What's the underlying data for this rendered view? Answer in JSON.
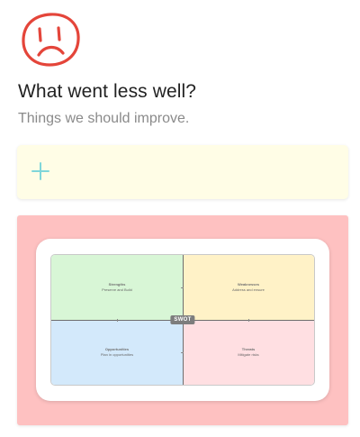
{
  "header": {
    "icon": "sad-face-icon",
    "icon_color": "#e4453a",
    "title": "What went less well?",
    "subtitle": "Things we should improve."
  },
  "add_card": {
    "icon": "plus-icon",
    "icon_color": "#7fd6da",
    "background": "#fffde6"
  },
  "note": {
    "background": "#fec1c1",
    "swot": {
      "badge": "SWOT",
      "quadrants": [
        {
          "title": "Strengths",
          "caption": "Preserve and Build"
        },
        {
          "title": "Weaknesses",
          "caption": "Address and ensure"
        },
        {
          "title": "Opportunities",
          "caption": "Plan in opportunities"
        },
        {
          "title": "Threats",
          "caption": "Mitigate risks"
        }
      ]
    }
  }
}
